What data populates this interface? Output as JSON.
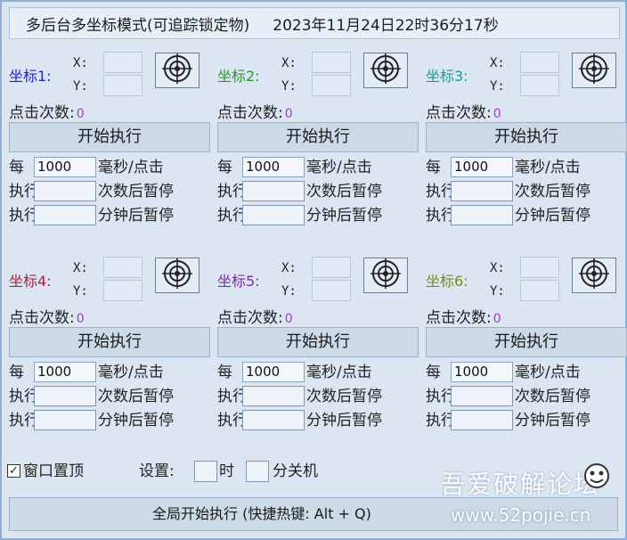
{
  "window": {
    "title": "多后台多坐标模式(可追踪锁定物)",
    "datetime": "2023年11月24日22时36分17秒"
  },
  "panels": [
    {
      "coord_label": "坐标1:",
      "label_color": "#2222cc",
      "x_label": "X:",
      "y_label": "Y:",
      "clicks_label": "点击次数:",
      "clicks": "0",
      "start_label": "开始执行",
      "every_label": "每",
      "interval": "1000",
      "interval_suffix": "毫秒/点击",
      "exec_label_1": "执行",
      "count_suffix": "次数后暂停",
      "exec_label_2": "执行",
      "minute_suffix": "分钟后暂停"
    },
    {
      "coord_label": "坐标2:",
      "label_color": "#2a9a2a",
      "x_label": "X:",
      "y_label": "Y:",
      "clicks_label": "点击次数:",
      "clicks": "0",
      "start_label": "开始执行",
      "every_label": "每",
      "interval": "1000",
      "interval_suffix": "毫秒/点击",
      "exec_label_1": "执行",
      "count_suffix": "次数后暂停",
      "exec_label_2": "执行",
      "minute_suffix": "分钟后暂停"
    },
    {
      "coord_label": "坐标3:",
      "label_color": "#1a9a9a",
      "x_label": "X:",
      "y_label": "Y:",
      "clicks_label": "点击次数:",
      "clicks": "0",
      "start_label": "开始执行",
      "every_label": "每",
      "interval": "1000",
      "interval_suffix": "毫秒/点击",
      "exec_label_1": "执行",
      "count_suffix": "次数后暂停",
      "exec_label_2": "执行",
      "minute_suffix": "分钟后暂停"
    },
    {
      "coord_label": "坐标4:",
      "label_color": "#b01c3c",
      "x_label": "X:",
      "y_label": "Y:",
      "clicks_label": "点击次数:",
      "clicks": "0",
      "start_label": "开始执行",
      "every_label": "每",
      "interval": "1000",
      "interval_suffix": "毫秒/点击",
      "exec_label_1": "执行",
      "count_suffix": "次数后暂停",
      "exec_label_2": "执行",
      "minute_suffix": "分钟后暂停"
    },
    {
      "coord_label": "坐标5:",
      "label_color": "#7a2aaa",
      "x_label": "X:",
      "y_label": "Y:",
      "clicks_label": "点击次数:",
      "clicks": "0",
      "start_label": "开始执行",
      "every_label": "每",
      "interval": "1000",
      "interval_suffix": "毫秒/点击",
      "exec_label_1": "执行",
      "count_suffix": "次数后暂停",
      "exec_label_2": "执行",
      "minute_suffix": "分钟后暂停"
    },
    {
      "coord_label": "坐标6:",
      "label_color": "#7a8a1a",
      "x_label": "X:",
      "y_label": "Y:",
      "clicks_label": "点击次数:",
      "clicks": "0",
      "start_label": "开始执行",
      "every_label": "每",
      "interval": "1000",
      "interval_suffix": "毫秒/点击",
      "exec_label_1": "执行",
      "count_suffix": "次数后暂停",
      "exec_label_2": "执行",
      "minute_suffix": "分钟后暂停"
    }
  ],
  "bottom": {
    "topmost_checked": true,
    "topmost_label": "窗口置顶",
    "settings_label": "设置:",
    "hour_label": "时",
    "minute_label": "分关机",
    "global_start_label": "全局开始执行 (快捷热键: Alt + Q)"
  },
  "watermark": {
    "text": "吾爱破解论坛",
    "url": "www.52pojie.cn"
  },
  "icons": {
    "target": "crosshair-target-icon",
    "check": "checkmark-icon",
    "logo": "52pojie-logo-icon"
  }
}
